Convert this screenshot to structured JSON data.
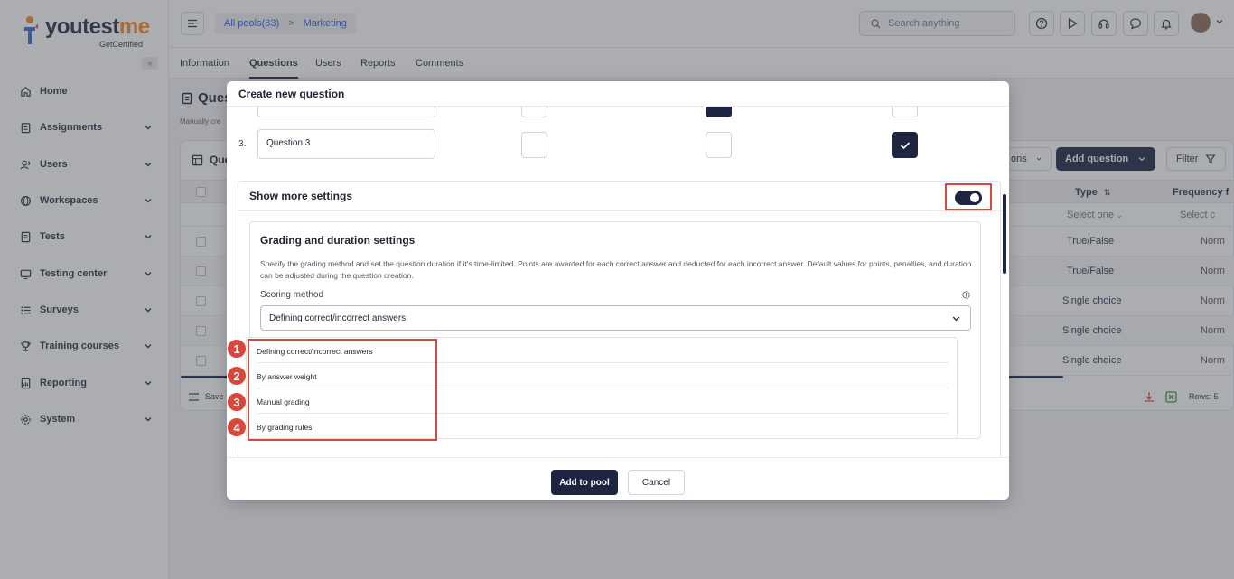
{
  "logo": {
    "word_main": "youtest",
    "word_accent": "me",
    "tagline": "GetCertified",
    "collapse_glyph": "«"
  },
  "sidebar": {
    "items": [
      {
        "label": "Home",
        "icon": "home-icon"
      },
      {
        "label": "Assignments",
        "icon": "clipboard-icon"
      },
      {
        "label": "Users",
        "icon": "users-icon"
      },
      {
        "label": "Workspaces",
        "icon": "globe-icon"
      },
      {
        "label": "Tests",
        "icon": "document-icon"
      },
      {
        "label": "Testing center",
        "icon": "monitor-icon"
      },
      {
        "label": "Surveys",
        "icon": "list-icon"
      },
      {
        "label": "Training courses",
        "icon": "trophy-icon"
      },
      {
        "label": "Reporting",
        "icon": "report-icon"
      },
      {
        "label": "System",
        "icon": "gear-icon"
      }
    ]
  },
  "topbar": {
    "breadcrumb_root": "All pools(83)",
    "breadcrumb_sep": ">",
    "breadcrumb_current": "Marketing",
    "search_placeholder": "Search anything",
    "icons": [
      "help-icon",
      "play-icon",
      "headset-icon",
      "chat-icon",
      "bell-icon"
    ]
  },
  "tabs": [
    {
      "label": "Information",
      "active": false
    },
    {
      "label": "Questions",
      "active": true
    },
    {
      "label": "Users",
      "active": false
    },
    {
      "label": "Reports",
      "active": false
    },
    {
      "label": "Comments",
      "active": false
    }
  ],
  "background_page": {
    "title": "Ques",
    "subtitle": "Manually cre",
    "panel_title": "Que",
    "actions_label": "ons",
    "add_question_label": "Add question",
    "filter_label": "Filter",
    "columns": {
      "type": "Type",
      "frequency": "Frequency f"
    },
    "filter_placeholders": {
      "type": "Select one",
      "frequency": "Select c"
    },
    "rows": [
      {
        "type": "True/False",
        "frequency": "Norm"
      },
      {
        "type": "True/False",
        "frequency": "Norm"
      },
      {
        "type": "Single choice",
        "frequency": "Norm"
      },
      {
        "type": "Single choice",
        "frequency": "Norm"
      },
      {
        "type": "Single choice",
        "frequency": "Norm"
      }
    ],
    "save_label": "Save",
    "rows_count_label": "Rows: 5"
  },
  "modal": {
    "title": "Create new question",
    "question_row": {
      "number": "3.",
      "value": "Question 3"
    },
    "settings": {
      "title": "Show more settings",
      "toggle_on": true,
      "grading": {
        "title": "Grading and duration settings",
        "description": "Specify the grading method and set the question duration if it's time-limited. Points are awarded for each correct answer and deducted for each incorrect answer. Default values for points, penalties, and duration can be adjusted during the question creation.",
        "scoring_label": "Scoring method",
        "scoring_selected": "Defining correct/incorrect answers"
      }
    },
    "scoring_options": [
      {
        "number": "1",
        "label": "Defining correct/incorrect answers"
      },
      {
        "number": "2",
        "label": "By answer weight"
      },
      {
        "number": "3",
        "label": "Manual grading"
      },
      {
        "number": "4",
        "label": "By grading rules"
      }
    ],
    "footer": {
      "add_label": "Add to pool",
      "cancel_label": "Cancel"
    }
  },
  "colors": {
    "primary": "#1d2540",
    "highlight": "#d9463b",
    "accent": "#f08a24",
    "link": "#2f5fd0"
  }
}
